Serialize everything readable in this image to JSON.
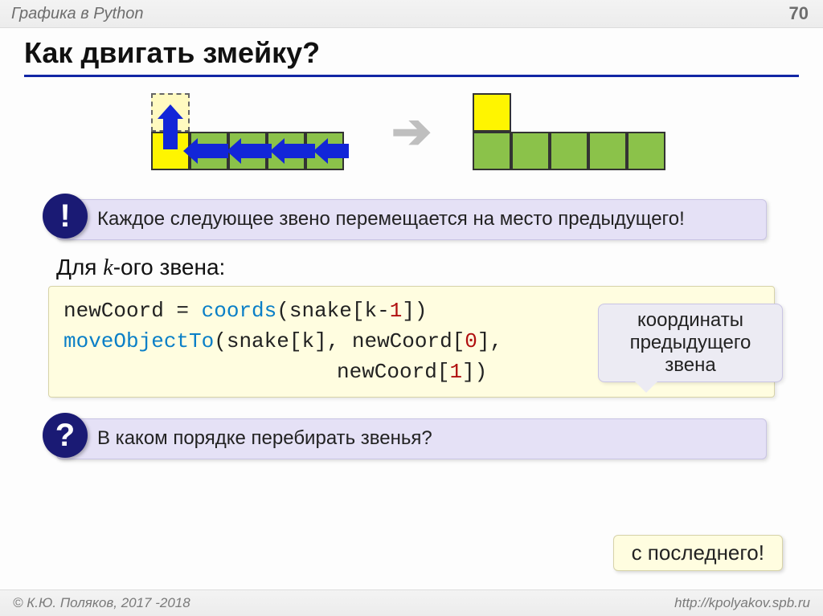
{
  "header": {
    "breadcrumb": "Графика в Python",
    "page_number": "70"
  },
  "title": "Как двигать змейку?",
  "callout_info": {
    "badge": "!",
    "text": "Каждое следующее звено перемещается на место предыдущего!"
  },
  "sub_label_pre": "Для ",
  "sub_label_k": "k",
  "sub_label_post": "-ого звена:",
  "annotation": "координаты предыдущего звена",
  "code": {
    "l1a": "newCoord = ",
    "l1b": "coords",
    "l1c": "(snake[k-",
    "l1n": "1",
    "l1d": "])",
    "l2a": "moveObjectTo",
    "l2b": "(snake[k], newCoord[",
    "l2n": "0",
    "l2c": "],",
    "l3a": "newCoord[",
    "l3n": "1",
    "l3b": "])"
  },
  "callout_question": {
    "badge": "?",
    "text": "В каком порядке перебирать звенья?"
  },
  "answer": "с последнего!",
  "footer": {
    "left": "© К.Ю. Поляков, 2017 -2018",
    "right": "http://kpolyakov.spb.ru"
  }
}
